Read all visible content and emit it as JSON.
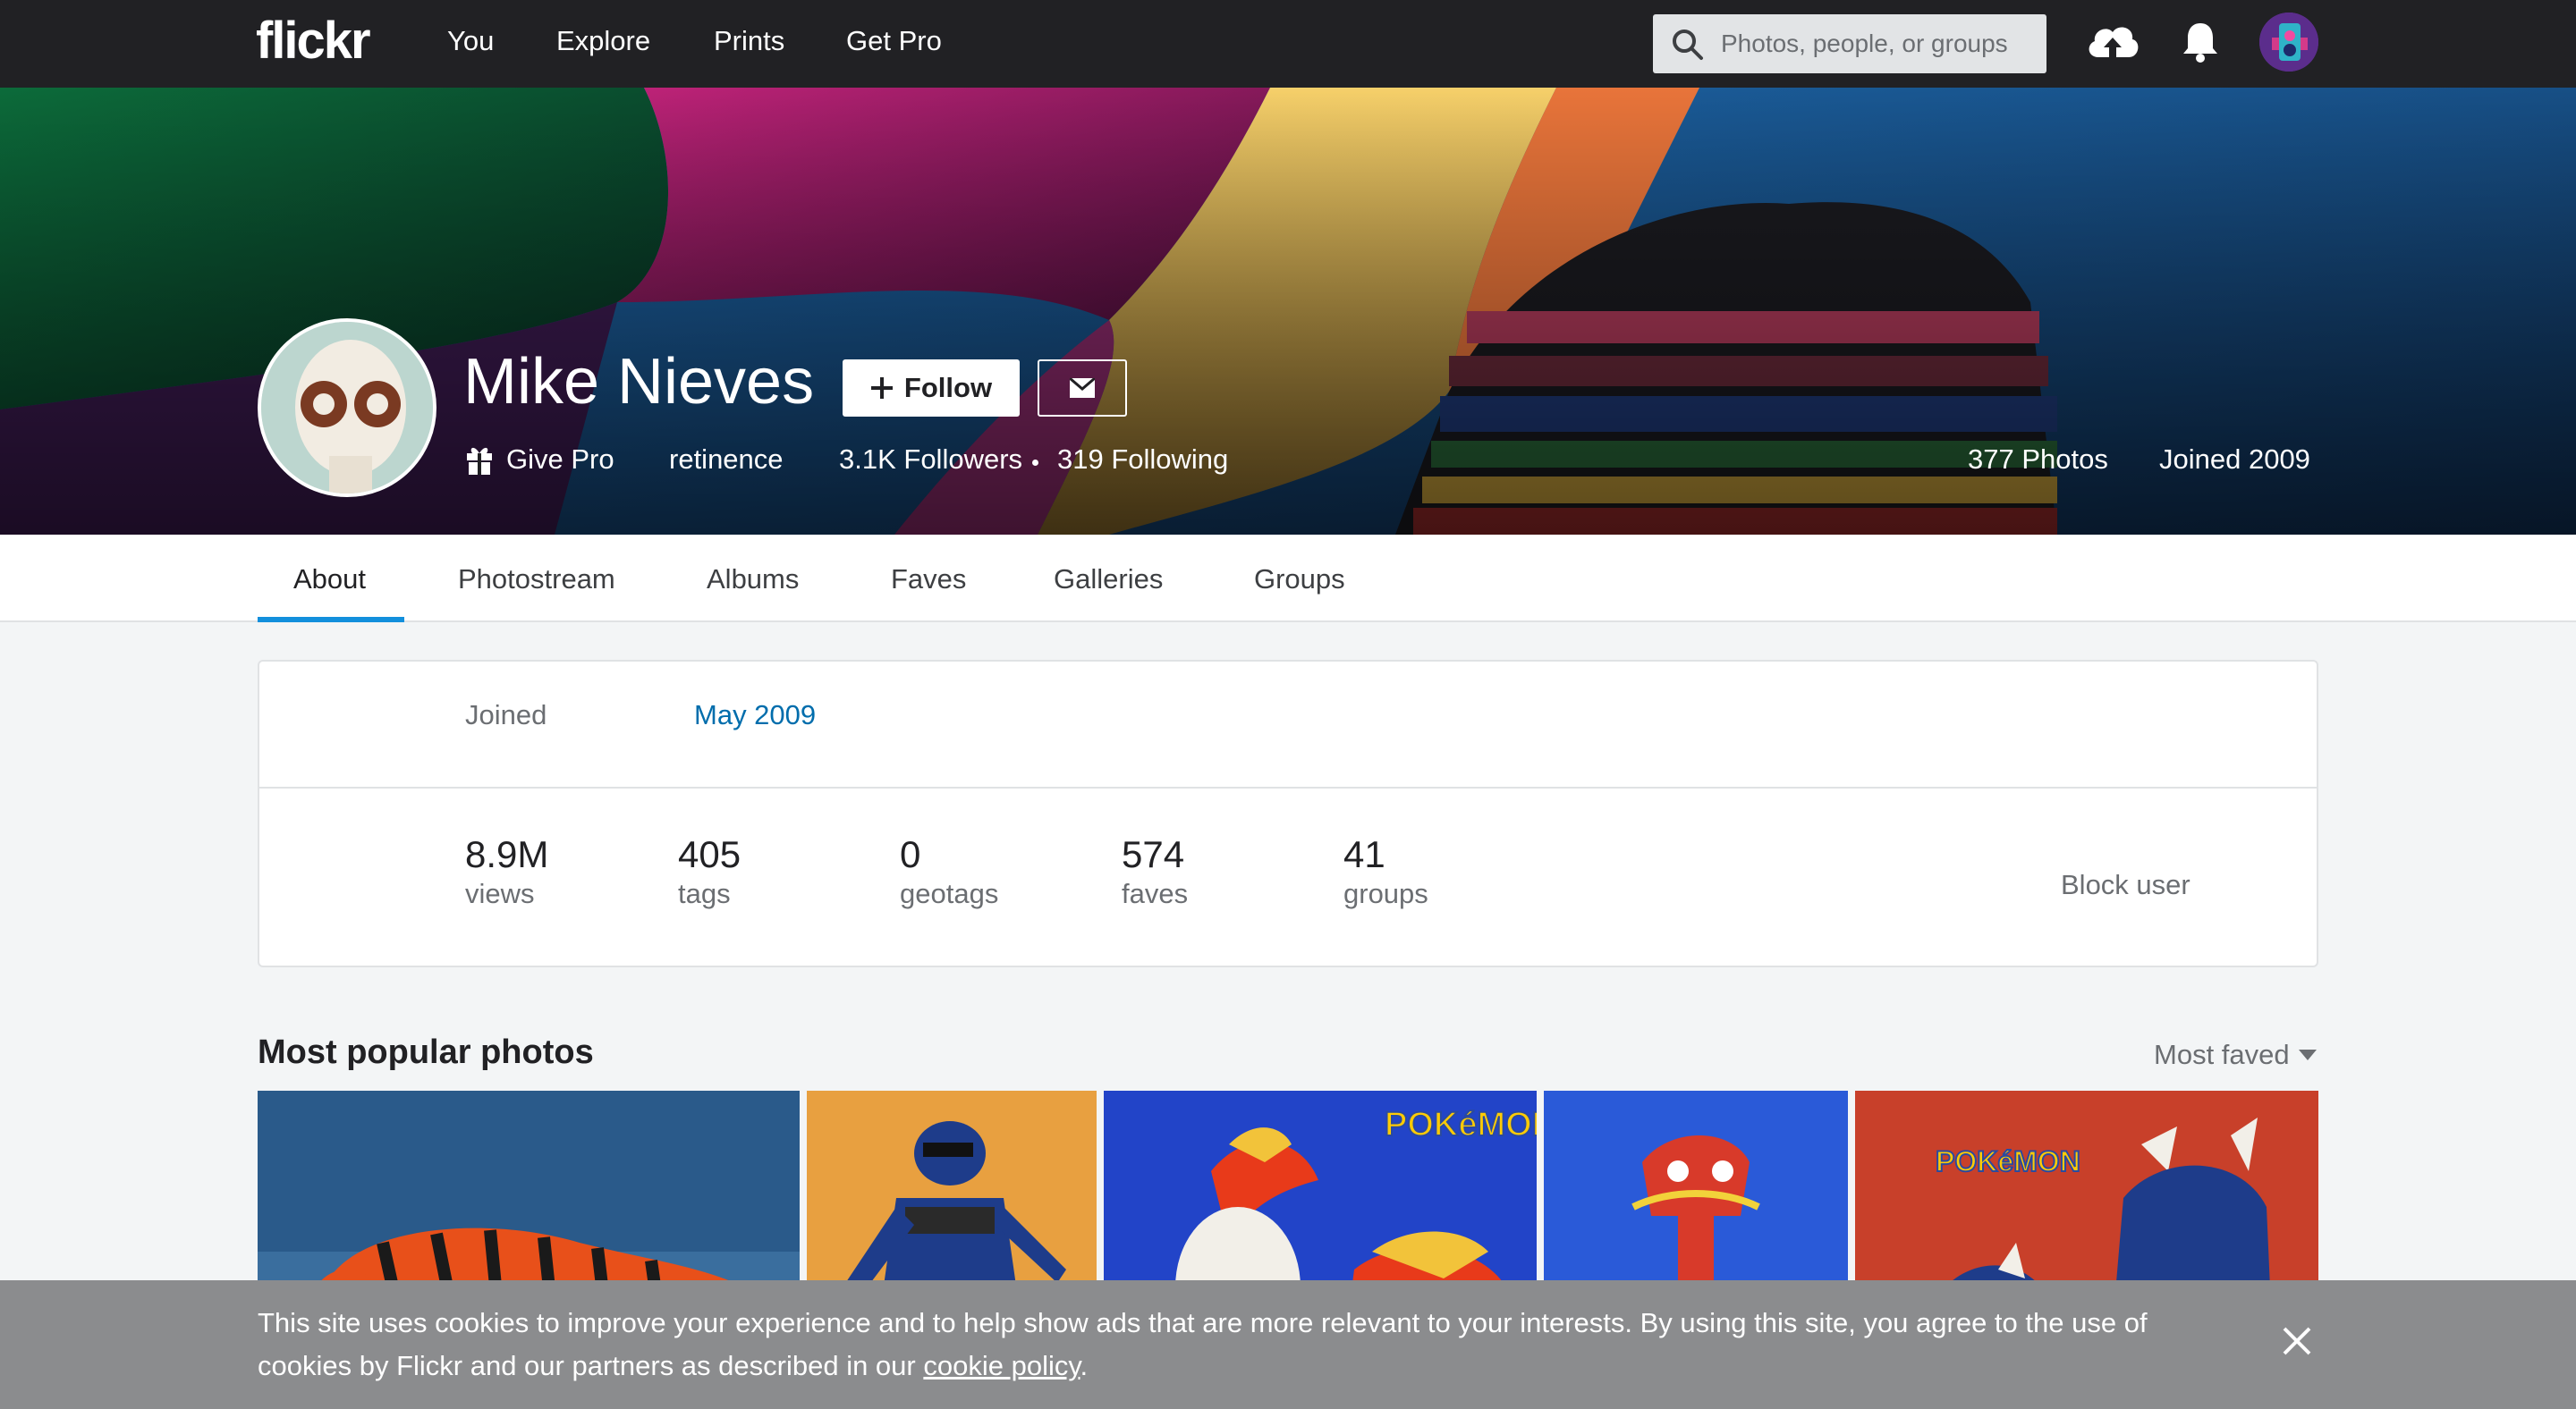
{
  "nav": {
    "logo": "flickr",
    "items": [
      "You",
      "Explore",
      "Prints",
      "Get Pro"
    ],
    "search_placeholder": "Photos, people, or groups",
    "icons": [
      "search-icon",
      "upload-icon",
      "bell-icon",
      "avatar"
    ]
  },
  "profile": {
    "name": "Mike Nieves",
    "follow_label": "Follow",
    "give_pro_label": "Give Pro",
    "username": "retinence",
    "followers": "3.1K Followers",
    "following": "319 Following",
    "photos": "377 Photos",
    "joined": "Joined 2009"
  },
  "tabs": [
    "About",
    "Photostream",
    "Albums",
    "Faves",
    "Galleries",
    "Groups"
  ],
  "about": {
    "joined_label": "Joined",
    "joined_value": "May 2009",
    "stats": [
      {
        "value": "8.9M",
        "label": "views"
      },
      {
        "value": "405",
        "label": "tags"
      },
      {
        "value": "0",
        "label": "geotags"
      },
      {
        "value": "574",
        "label": "faves"
      },
      {
        "value": "41",
        "label": "groups"
      }
    ],
    "block_user_label": "Block user"
  },
  "popular": {
    "title": "Most popular photos",
    "sort_label": "Most faved"
  },
  "photo_labels": {
    "photo3": "POKéMON",
    "photo5": "POKéMON"
  },
  "cookie": {
    "text": "This site uses cookies to improve your experience and to help show ads that are more relevant to your interests. By using this site, you agree to the use of cookies by Flickr and our partners as described in our ",
    "link": "cookie policy",
    "suffix": "."
  },
  "colors": {
    "nav_bg": "#212124",
    "accent": "#128fdc",
    "link": "#006dac",
    "cookie_bg": "#8b8c8e"
  }
}
